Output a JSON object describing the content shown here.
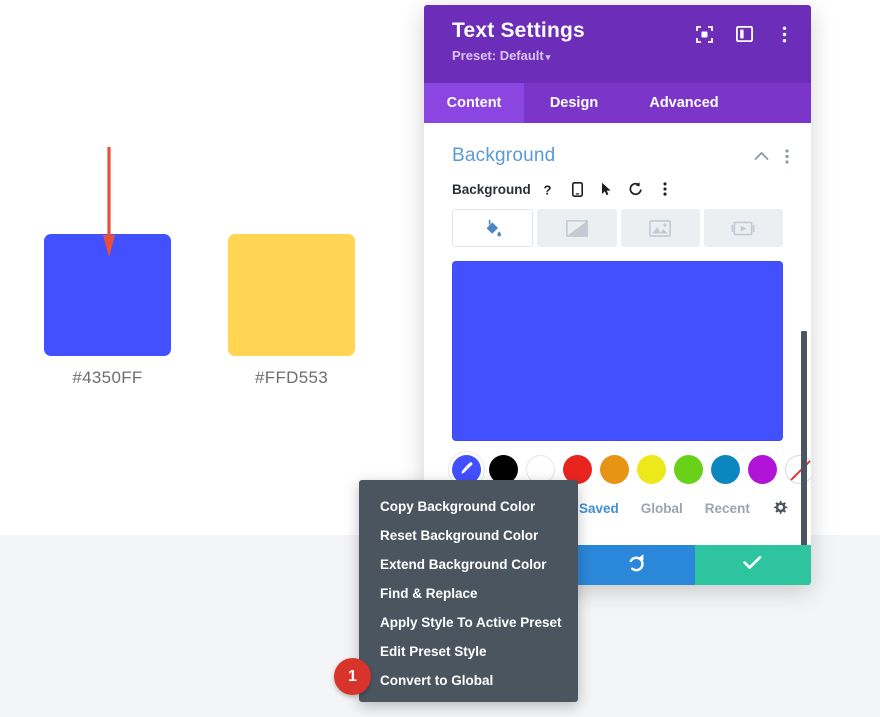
{
  "page": {
    "bg_top_color": "#ffffff",
    "bg_bottom_color": "#f4f5f6"
  },
  "swatch_demo": {
    "annotation_arrow_color": "#e8503a",
    "items": [
      {
        "label": "#4350FF",
        "color": "#4350FF",
        "name": "blue"
      },
      {
        "label": "#FFD553",
        "color": "#FFD553",
        "name": "yellow"
      }
    ]
  },
  "modal": {
    "title": "Text Settings",
    "preset_label": "Preset: Default",
    "preset_caret": "▾",
    "header_color": "#6C2EB9",
    "header_icons": [
      {
        "name": "focus-mode-icon"
      },
      {
        "name": "split-view-icon"
      },
      {
        "name": "more-options-icon"
      }
    ],
    "tabs": [
      {
        "label": "Content",
        "active": true
      },
      {
        "label": "Design",
        "active": false
      },
      {
        "label": "Advanced",
        "active": false
      }
    ],
    "section": {
      "title": "Background",
      "title_color": "#5a9ad6",
      "collapse_icon": "chevron-up-icon",
      "menu_icon": "more-options-icon"
    },
    "field": {
      "label": "Background",
      "icons": [
        "help-icon",
        "responsive-icon",
        "hover-icon",
        "reset-icon",
        "more-options-icon"
      ]
    },
    "background_types": [
      {
        "name": "color-fill",
        "active": true
      },
      {
        "name": "gradient",
        "active": false
      },
      {
        "name": "image",
        "active": false
      },
      {
        "name": "video",
        "active": false
      }
    ],
    "preview_color": "#4350FF",
    "swatches": [
      {
        "color": "#4350FF",
        "selected": true,
        "name": "custom-color"
      },
      {
        "color": "#000000",
        "selected": false,
        "name": "black"
      },
      {
        "color": "#ffffff",
        "selected": false,
        "name": "white"
      },
      {
        "color": "#e8241f",
        "selected": false,
        "name": "red"
      },
      {
        "color": "#e79414",
        "selected": false,
        "name": "orange"
      },
      {
        "color": "#ece81a",
        "selected": false,
        "name": "yellow"
      },
      {
        "color": "#68d118",
        "selected": false,
        "name": "green"
      },
      {
        "color": "#0c86bf",
        "selected": false,
        "name": "blue"
      },
      {
        "color": "#b114d6",
        "selected": false,
        "name": "purple"
      },
      {
        "color": "transparent",
        "selected": false,
        "name": "none"
      }
    ],
    "palette_tabs": [
      {
        "label": "Saved",
        "active": true
      },
      {
        "label": "Global",
        "active": false
      },
      {
        "label": "Recent",
        "active": false
      }
    ],
    "palette_settings_icon": "gear-icon",
    "action_bar": [
      {
        "name": "preset-button",
        "color": "#8B3FD4"
      },
      {
        "name": "undo-button",
        "color": "#2b87da",
        "icon": "redo-icon"
      },
      {
        "name": "save-button",
        "color": "#2ec4a0",
        "icon": "check-icon"
      }
    ]
  },
  "context_menu": {
    "background": "#4b555f",
    "items": [
      {
        "label": "Copy Background Color"
      },
      {
        "label": "Reset Background Color"
      },
      {
        "label": "Extend Background Color"
      },
      {
        "label": "Find & Replace"
      },
      {
        "label": "Apply Style To Active Preset"
      },
      {
        "label": "Edit Preset Style"
      },
      {
        "label": "Convert to Global"
      }
    ]
  },
  "step_badge": {
    "number": "1",
    "color": "#d9342b"
  }
}
